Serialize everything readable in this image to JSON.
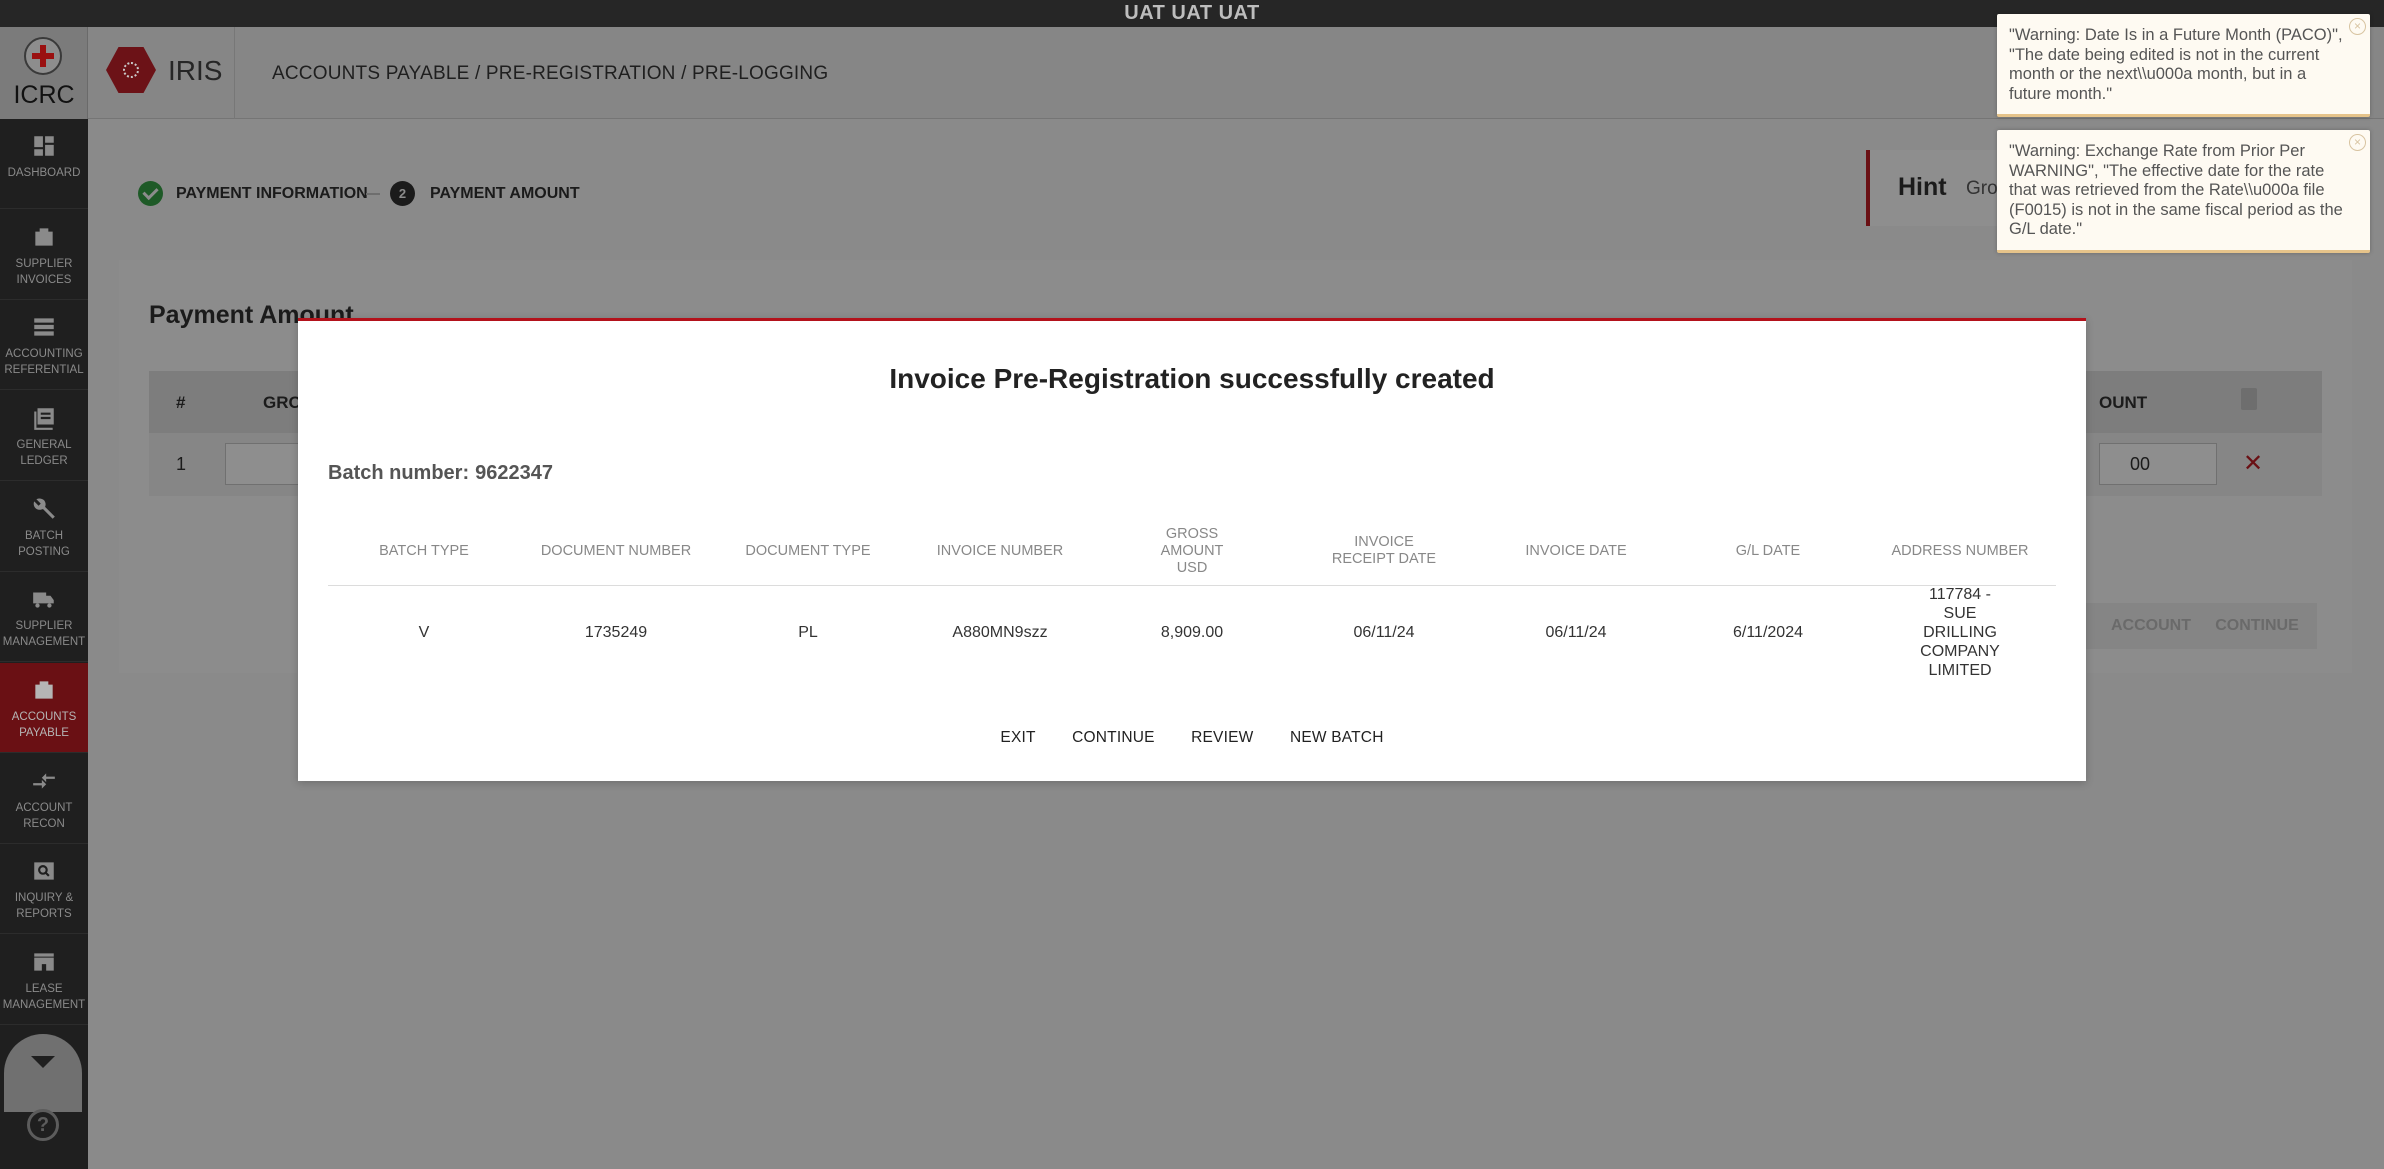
{
  "env": {
    "label": "UAT UAT UAT"
  },
  "logo": {
    "text": "ICRC"
  },
  "app": {
    "name": "IRIS"
  },
  "breadcrumb": "ACCOUNTS PAYABLE / PRE-REGISTRATION / PRE-LOGGING",
  "sidebar": {
    "items": [
      {
        "label": "DASHBOARD",
        "icon": "dashboard-icon"
      },
      {
        "label": "SUPPLIER INVOICES",
        "icon": "briefcase-icon"
      },
      {
        "label": "ACCOUNTING REFERENTIAL",
        "icon": "list-icon"
      },
      {
        "label": "GENERAL LEDGER",
        "icon": "ledger-icon"
      },
      {
        "label": "BATCH POSTING",
        "icon": "wrench-icon"
      },
      {
        "label": "SUPPLIER MANAGEMENT",
        "icon": "truck-icon"
      },
      {
        "label": "ACCOUNTS PAYABLE",
        "icon": "briefcase-icon",
        "active": true
      },
      {
        "label": "ACCOUNT RECON",
        "icon": "arrows-icon"
      },
      {
        "label": "INQUIRY & REPORTS",
        "icon": "search-icon"
      },
      {
        "label": "LEASE MANAGEMENT",
        "icon": "store-icon"
      }
    ]
  },
  "steps": {
    "step1": "PAYMENT INFORMATION",
    "step2_number": "2",
    "step2": "PAYMENT AMOUNT"
  },
  "hint": {
    "title": "Hint",
    "text": "Gros"
  },
  "card": {
    "title": "Payment Amount",
    "columns": {
      "hash": "#",
      "gross": "GRO",
      "amount": "OUNT"
    },
    "row": {
      "num": "1",
      "amount": "00"
    },
    "buttons": {
      "account": "ACCOUNT",
      "continue": "CONTINUE"
    }
  },
  "toasts": [
    {
      "text": "\"Warning: Date Is in a Future Month (PACO)\", \"The date being edited is not in the current month or the next\\\\u000a month, but in a future month.\""
    },
    {
      "text": "\"Warning: Exchange Rate from Prior Per WARNING\", \"The effective date for the rate that was retrieved from the Rate\\\\u000a file (F0015) is not in the same fiscal period as the G/L date.\""
    }
  ],
  "modal": {
    "title": "Invoice Pre-Registration successfully created",
    "batch_label": "Batch number:",
    "batch_number": "9622347",
    "columns": [
      "BATCH TYPE",
      "DOCUMENT NUMBER",
      "DOCUMENT TYPE",
      "INVOICE NUMBER",
      "GROSS AMOUNT USD",
      "INVOICE RECEIPT DATE",
      "INVOICE DATE",
      "G/L DATE",
      "ADDRESS NUMBER"
    ],
    "row": {
      "batch_type": "V",
      "document_number": "1735249",
      "document_type": "PL",
      "invoice_number": "A880MN9szz",
      "gross_amount": "8,909.00",
      "invoice_receipt_date": "06/11/24",
      "invoice_date": "06/11/24",
      "gl_date": "6/11/2024",
      "address_number": "117784 - SUE DRILLING COMPANY LIMITED"
    },
    "actions": {
      "exit": "EXIT",
      "continue": "CONTINUE",
      "review": "REVIEW",
      "new_batch": "NEW BATCH"
    }
  },
  "colors": {
    "accent": "#b3121b",
    "toast_bg": "#fefaf2",
    "sidebar_bg": "#1f1f1f"
  }
}
